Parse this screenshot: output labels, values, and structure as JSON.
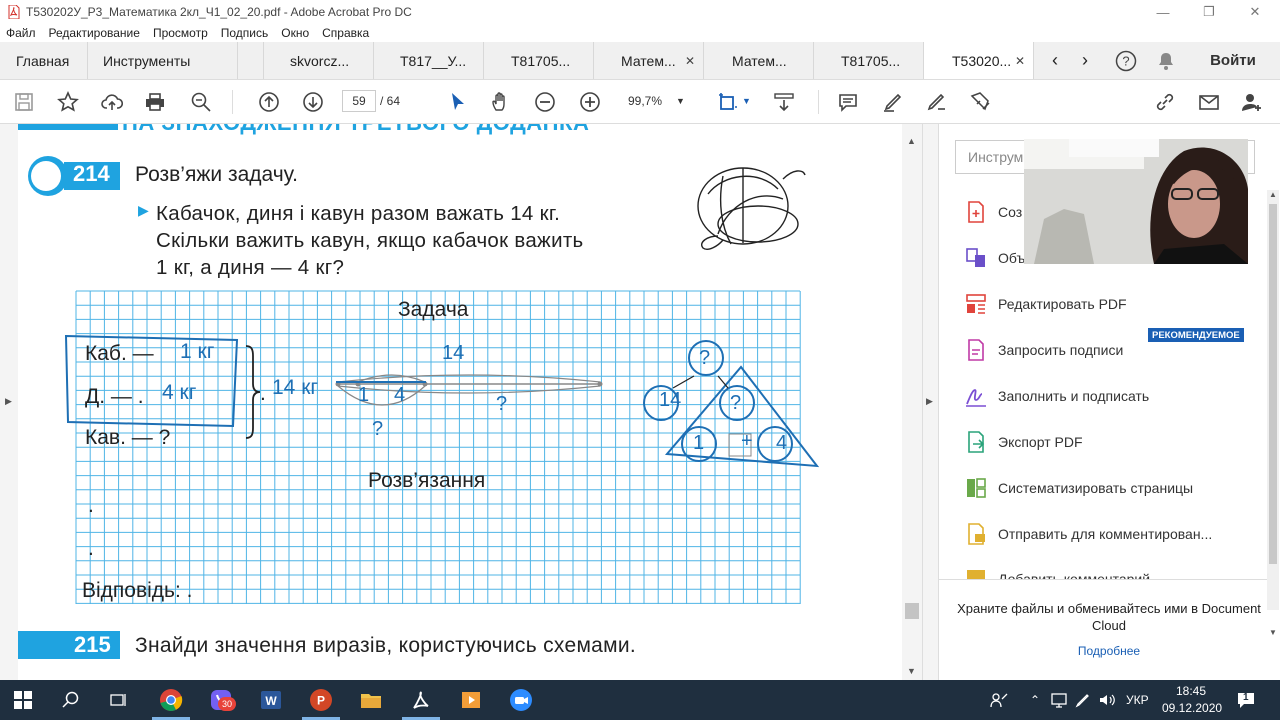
{
  "window": {
    "title": "T530202У_Р3_Математика 2кл_Ч1_02_20.pdf - Adobe Acrobat Pro DC"
  },
  "menu": [
    "Файл",
    "Редактирование",
    "Просмотр",
    "Подпись",
    "Окно",
    "Справка"
  ],
  "tabs": {
    "home": "Главная",
    "tools": "Инструменты",
    "docs": [
      {
        "label": "skvorcz...",
        "active": false
      },
      {
        "label": "T817__У...",
        "active": false
      },
      {
        "label": "T81705...",
        "active": false
      },
      {
        "label": "Матем...",
        "active": false
      },
      {
        "label": "Матем...",
        "active": false
      },
      {
        "label": "T81705...",
        "active": false
      },
      {
        "label": "T53020...",
        "active": true
      }
    ],
    "signin": "Войти"
  },
  "toolbar": {
    "page_current": "59",
    "page_total": "/ 64",
    "zoom": "99,7%"
  },
  "document": {
    "header_partial": "НА ЗНАХОДЖЕННЯ ТРЕТЬОГО ДОДАНКА",
    "task214": {
      "number": "214",
      "title": "Розв’яжи задачу.",
      "line1": "Кабачок, диня і кавун разом важать 14 кг.",
      "line2": "Скільки важить кавун, якщо кабачок важить",
      "line3": "1 кг, а диня — 4 кг?",
      "zadacha": "Задача",
      "kab": "Каб.  —",
      "kab_val": "1 кг",
      "dyn": "Д.  —  .",
      "dyn_val": "4 кг",
      "kav": "Кав.  —  ?",
      "total": "14 кг",
      "seg_top": "14",
      "seg_1": "1",
      "seg_4": "4",
      "seg_q1": "?",
      "seg_q2": "?",
      "tri_top": "?",
      "tri_14": "14",
      "tri_q": "?",
      "tri_1": "1",
      "tri_4": "4",
      "solution": "Розв’язання",
      "dot1": ".",
      "dot2": ".",
      "answer": "Відповідь:  ."
    },
    "task215": {
      "number": "215",
      "title": "Знайди значення виразів, користуючись схемами."
    }
  },
  "panel": {
    "search_placeholder": "Инструм",
    "items": [
      {
        "label": "Соз",
        "icon": "create-pdf-icon",
        "color": "#e0443c"
      },
      {
        "label": "Объ",
        "icon": "combine-icon",
        "color": "#6a4fc9"
      },
      {
        "label": "Редактировать PDF",
        "icon": "edit-pdf-icon",
        "color": "#e0443c"
      },
      {
        "label": "Запросить подписи",
        "icon": "request-sign-icon",
        "color": "#c03aa6"
      },
      {
        "label": "Заполнить и подписать",
        "icon": "fill-sign-icon",
        "color": "#7b4fd4"
      },
      {
        "label": "Экспорт PDF",
        "icon": "export-pdf-icon",
        "color": "#2aa37a"
      },
      {
        "label": "Систематизировать страницы",
        "icon": "organize-icon",
        "color": "#6aa94a"
      },
      {
        "label": "Отправить для комментирован...",
        "icon": "send-comment-icon",
        "color": "#e0b030"
      },
      {
        "label": "Добавить комментарий",
        "icon": "comment-icon",
        "color": "#e0b030"
      }
    ],
    "badge": "РЕКОМЕНДУЕМОЕ",
    "promo": "Храните файлы и обменивайтесь ими в Document Cloud",
    "promo_link": "Подробнее"
  },
  "taskbar": {
    "lang": "УКР",
    "time": "18:45",
    "date": "09.12.2020",
    "badge_viber": "30",
    "notifications": "1"
  }
}
